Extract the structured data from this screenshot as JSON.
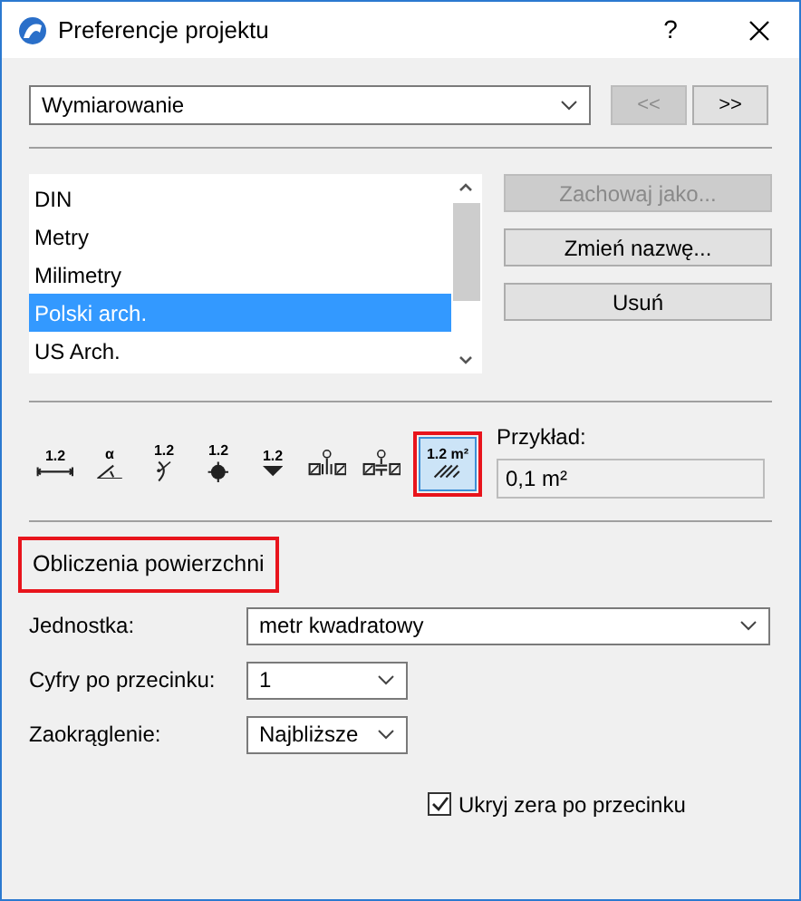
{
  "window": {
    "title": "Preferencje projektu",
    "help": "?"
  },
  "category": {
    "value": "Wymiarowanie"
  },
  "nav_buttons": [
    {
      "label": "<<",
      "disabled": true
    },
    {
      "label": ">>",
      "disabled": false
    }
  ],
  "schemes": [
    {
      "label": "DIN",
      "selected": false
    },
    {
      "label": "Metry",
      "selected": false
    },
    {
      "label": "Milimetry",
      "selected": false
    },
    {
      "label": "Polski arch.",
      "selected": true
    },
    {
      "label": "US Arch.",
      "selected": false
    }
  ],
  "scheme_buttons": [
    {
      "label": "Zachowaj jako...",
      "disabled": true
    },
    {
      "label": "Zmień nazwę...",
      "disabled": false
    },
    {
      "label": "Usuń",
      "disabled": false
    }
  ],
  "tools": [
    {
      "kind": "linear",
      "label": "1.2",
      "selected": false,
      "highlighted": false
    },
    {
      "kind": "angle",
      "label": "α",
      "selected": false,
      "highlighted": false
    },
    {
      "kind": "radius",
      "label": "1.2",
      "selected": false,
      "highlighted": false
    },
    {
      "kind": "level",
      "label": "1.2",
      "selected": false,
      "highlighted": false
    },
    {
      "kind": "elevation",
      "label": "1.2",
      "selected": false,
      "highlighted": false
    },
    {
      "kind": "door",
      "selected": false,
      "highlighted": false
    },
    {
      "kind": "sill",
      "selected": false,
      "highlighted": false
    },
    {
      "kind": "area",
      "label": "1.2 m²",
      "selected": true,
      "highlighted": true
    }
  ],
  "example": {
    "label": "Przykład:",
    "value": "0,1 m²"
  },
  "section": {
    "title": "Obliczenia powierzchni",
    "highlighted": true
  },
  "fields": [
    {
      "label": "Jednostka:",
      "value": "metr kwadratowy",
      "wide": true
    },
    {
      "label": "Cyfry po przecinku:",
      "value": "1",
      "wide": false
    },
    {
      "label": "Zaokrąglenie:",
      "value": "Najbliższe",
      "wide": false
    }
  ],
  "hide_zeros": {
    "label": "Ukryj zera po przecinku",
    "checked": true
  }
}
